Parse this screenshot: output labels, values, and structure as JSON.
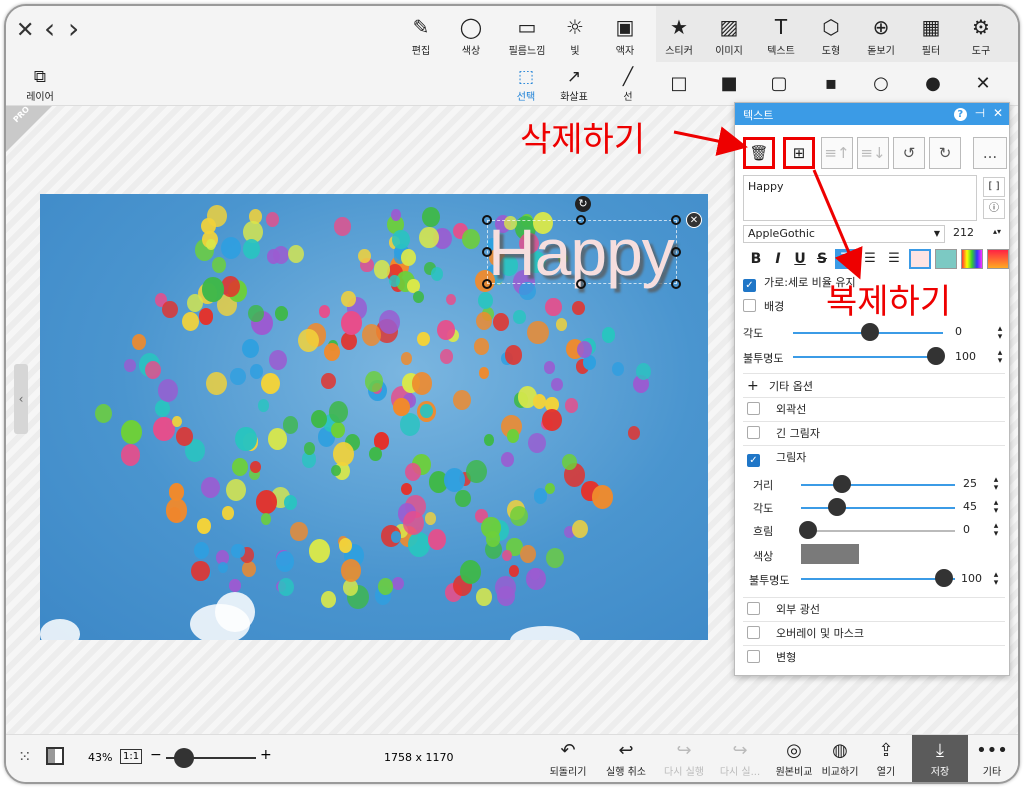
{
  "nav": {
    "close": "✕",
    "back": "‹",
    "forward": "›"
  },
  "toolbar": {
    "tools": [
      {
        "label": "편집",
        "icon": "edit-icon",
        "glyph": "✎"
      },
      {
        "label": "색상",
        "icon": "color-icon",
        "glyph": "◯"
      },
      {
        "label": "필름느낌",
        "icon": "film-icon",
        "glyph": "▭"
      },
      {
        "label": "빛",
        "icon": "light-icon",
        "glyph": "☼"
      },
      {
        "label": "액자",
        "icon": "frame-icon",
        "glyph": "▣"
      },
      {
        "label": "스티커",
        "icon": "sticker-icon",
        "glyph": "★"
      },
      {
        "label": "이미지",
        "icon": "image-icon",
        "glyph": "▨"
      },
      {
        "label": "텍스트",
        "icon": "text-icon",
        "glyph": "T"
      },
      {
        "label": "도형",
        "icon": "shape-icon",
        "glyph": "⬡"
      },
      {
        "label": "돋보기",
        "icon": "magnifier-icon",
        "glyph": "⊕"
      },
      {
        "label": "필터",
        "icon": "filter-icon",
        "glyph": "▦"
      },
      {
        "label": "도구",
        "icon": "tools-icon",
        "glyph": "⚙"
      }
    ],
    "layer_label": "레이어",
    "sub_tools": [
      {
        "label": "선택",
        "icon": "select-icon",
        "glyph": "⬚"
      },
      {
        "label": "화살표",
        "icon": "arrow-icon",
        "glyph": "↗"
      },
      {
        "label": "선",
        "icon": "line-icon",
        "glyph": "╱"
      }
    ],
    "shapes": [
      "□",
      "■",
      "▢",
      "▪",
      "○",
      "●"
    ],
    "close_glyph": "✕"
  },
  "canvas": {
    "text": "Happy",
    "pro_badge": "PRO",
    "rotate_glyph": "↻",
    "delete_glyph": "✕"
  },
  "panel": {
    "title": "텍스트",
    "help": "?",
    "pin": "⊣",
    "close": "✕",
    "more": "...",
    "text_value": "Happy",
    "bracket_btn": "[ ]",
    "info_btn": "ⓘ",
    "font_name": "AppleGothic",
    "font_size": "212",
    "format": {
      "bold": "B",
      "italic": "I",
      "underline": "U",
      "strike": "S"
    },
    "keep_ratio_label": "가로:세로 비율 유지",
    "background_label": "배경",
    "angle_label": "각도",
    "angle_value": "0",
    "opacity_label": "불투명도",
    "opacity_value": "100",
    "more_options_label": "기타 옵션",
    "outline_label": "외곽선",
    "long_shadow_label": "긴 그림자",
    "shadow_label": "그림자",
    "shadow": {
      "distance_label": "거리",
      "distance_value": "25",
      "angle_label": "각도",
      "angle_value": "45",
      "blur_label": "흐림",
      "blur_value": "0",
      "color_label": "색상",
      "color": "#7a7a7a",
      "opacity_label": "불투명도",
      "opacity_value": "100"
    },
    "outer_glow_label": "외부 광선",
    "overlay_label": "오버레이 및 마스크",
    "transform_label": "변형"
  },
  "annotations": {
    "delete": "삭제하기",
    "duplicate": "복제하기"
  },
  "bottom": {
    "zoom": "43%",
    "ratio": "1:1",
    "minus": "−",
    "plus": "+",
    "dimensions": "1758 x 1170",
    "actions": [
      {
        "label": "되돌리기",
        "glyph": "↶",
        "icon": "revert-icon",
        "disabled": false
      },
      {
        "label": "실행 취소",
        "glyph": "↩",
        "icon": "undo-icon",
        "disabled": false
      },
      {
        "label": "다시 실행",
        "glyph": "↪",
        "icon": "redo-icon",
        "disabled": true
      },
      {
        "label": "다시 실...",
        "glyph": "↪",
        "icon": "redo-all-icon",
        "disabled": true
      },
      {
        "label": "원본비교",
        "glyph": "◎",
        "icon": "compare-original-icon",
        "disabled": false
      },
      {
        "label": "비교하기",
        "glyph": "◍",
        "icon": "compare-icon",
        "disabled": false
      },
      {
        "label": "열기",
        "glyph": "⇪",
        "icon": "open-icon",
        "disabled": false
      },
      {
        "label": "저장",
        "glyph": "⤓",
        "icon": "save-icon",
        "disabled": false
      },
      {
        "label": "기타",
        "glyph": "•••",
        "icon": "more-icon",
        "disabled": false
      }
    ]
  },
  "colors": {
    "accent": "#3b9be6",
    "annotation": "#ee0000"
  }
}
